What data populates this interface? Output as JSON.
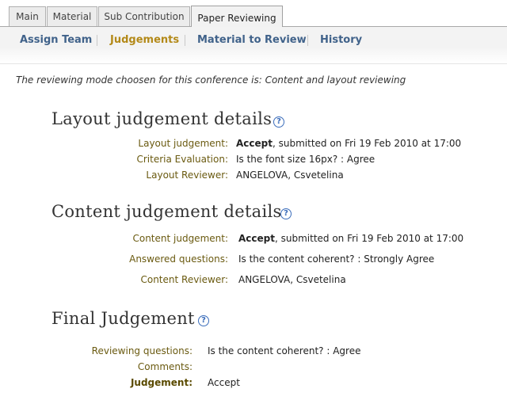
{
  "tabs": [
    {
      "label": "Main"
    },
    {
      "label": "Material"
    },
    {
      "label": "Sub Contribution"
    },
    {
      "label": "Paper Reviewing"
    }
  ],
  "subnav": [
    {
      "label": "Assign Team"
    },
    {
      "label": "Judgements"
    },
    {
      "label": "Material to Review"
    },
    {
      "label": "History"
    }
  ],
  "mode_note": "The reviewing mode choosen for this conference is: Content and layout reviewing",
  "layout": {
    "title": "Layout judgement details",
    "judgement_label": "Layout judgement:",
    "judgement_value": "Accept",
    "judgement_rest": ", submitted on Fri 19 Feb 2010 at 17:00",
    "criteria_label": "Criteria Evaluation:",
    "criteria_value": "Is the font size 16px? : Agree",
    "reviewer_label": "Layout Reviewer:",
    "reviewer_value": "ANGELOVA, Csvetelina"
  },
  "content": {
    "title": "Content judgement details",
    "judgement_label": "Content judgement:",
    "judgement_value": "Accept",
    "judgement_rest": ", submitted on Fri 19 Feb 2010 at 17:00",
    "answered_label": "Answered questions:",
    "answered_value": "Is the content coherent? : Strongly Agree",
    "reviewer_label": "Content Reviewer:",
    "reviewer_value": "ANGELOVA, Csvetelina"
  },
  "final": {
    "title": "Final Judgement",
    "questions_label": "Reviewing questions:",
    "questions_value": "Is the content coherent? : Agree",
    "comments_label": "Comments:",
    "comments_value": "",
    "judgement_label": "Judgement:",
    "judgement_value": "Accept"
  },
  "icons": {
    "help": "?"
  }
}
